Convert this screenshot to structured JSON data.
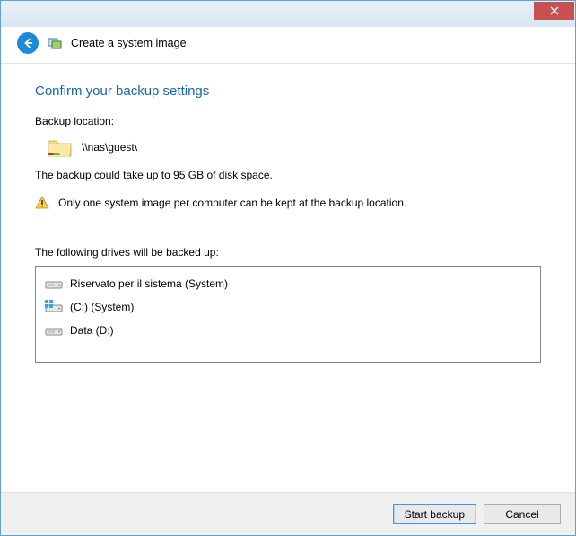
{
  "header": {
    "title": "Create a system image"
  },
  "page": {
    "heading": "Confirm your backup settings",
    "backup_location_label": "Backup location:",
    "backup_location_path": "\\\\nas\\guest\\",
    "size_note": "The backup could take up to 95 GB of disk space.",
    "warning": "Only one system image per computer can be kept at the backup location.",
    "drives_label": "The following drives will be backed up:",
    "drives": [
      {
        "label": "Riservato per il sistema (System)",
        "type": "hdd"
      },
      {
        "label": "(C:) (System)",
        "type": "windows"
      },
      {
        "label": "Data (D:)",
        "type": "hdd"
      }
    ]
  },
  "footer": {
    "start": "Start backup",
    "cancel": "Cancel"
  }
}
